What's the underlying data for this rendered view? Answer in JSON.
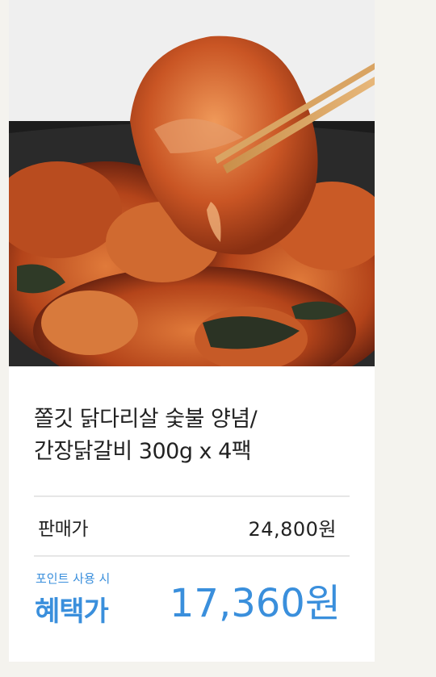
{
  "product": {
    "title_line1": "쫄깃 닭다리살 숯불 양념/",
    "title_line2": "간장닭갈비 300g x 4팩",
    "image_icon": "food-photo"
  },
  "pricing": {
    "sale_label": "판매가",
    "sale_price": "24,800원",
    "point_note": "포인트 사용 시",
    "benefit_label": "혜택가",
    "benefit_price": "17,360원"
  },
  "colors": {
    "accent": "#3a8fdc",
    "text": "#222222",
    "background": "#f4f3ee"
  }
}
